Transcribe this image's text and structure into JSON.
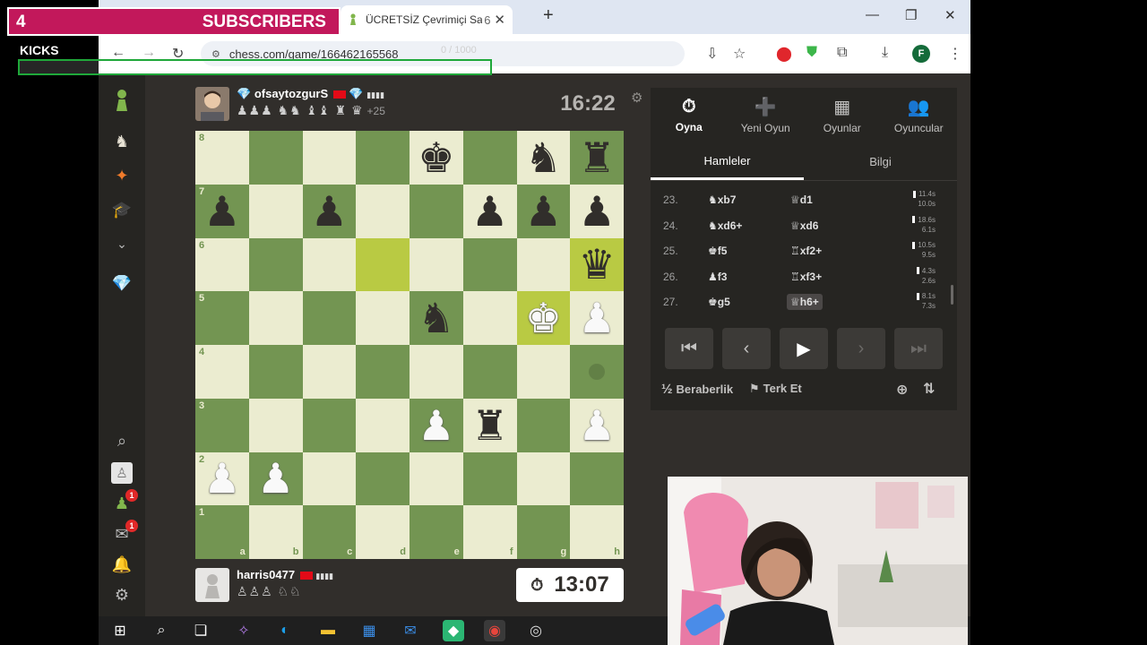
{
  "overlay": {
    "subscriber_count": "4",
    "subscriber_label": "SUBSCRIBERS",
    "kicks_label": "KICKS",
    "progress_text": "0 / 1000",
    "progress_fraction": 0
  },
  "browser": {
    "tab_title": "ÜCRETSİZ Çevrimiçi Satranç Oyunu",
    "tab_badge": "6",
    "url": "chess.com/game/166462165568",
    "profile_letter": "F"
  },
  "game": {
    "top_player": {
      "name": "ofsaytozgurS",
      "rating_dots": "▮▮▮▮",
      "captured": "♟♟♟ ♞♞ ♝♝ ♜ ♛",
      "advantage": "+25",
      "clock": "16:22"
    },
    "bottom_player": {
      "name": "harris0477",
      "rating_dots": "▮▮▮▮",
      "captured": "♙♙♙ ♘♘",
      "clock": "13:07"
    },
    "board": {
      "ranks": [
        "8",
        "7",
        "6",
        "5",
        "4",
        "3",
        "2",
        "1"
      ],
      "files": [
        "a",
        "b",
        "c",
        "d",
        "e",
        "f",
        "g",
        "h"
      ],
      "rows": [
        [
          "",
          "",
          "",
          "",
          "bk",
          "",
          "bn",
          "br"
        ],
        [
          "bp",
          "",
          "bp",
          "",
          "",
          "bp",
          "bp",
          "bp"
        ],
        [
          "",
          "",
          "",
          "",
          "",
          "",
          "",
          "bq"
        ],
        [
          "",
          "",
          "",
          "",
          "bn",
          "",
          "wk",
          "wp"
        ],
        [
          "",
          "",
          "",
          "",
          "",
          "",
          "",
          ""
        ],
        [
          "",
          "",
          "",
          "",
          "wp",
          "br",
          "",
          "wp"
        ],
        [
          "wp",
          "wp",
          "",
          "",
          "",
          "",
          "",
          ""
        ],
        [
          "",
          "",
          "",
          "",
          "",
          "",
          "",
          ""
        ]
      ],
      "highlights": [
        "d6",
        "h6",
        "g5"
      ],
      "move_hint": "h4"
    }
  },
  "panel": {
    "tabs": [
      {
        "label": "Oyna",
        "icon": "stopwatch-icon",
        "glyph": "⏱"
      },
      {
        "label": "Yeni Oyun",
        "icon": "plus-icon",
        "glyph": "➕"
      },
      {
        "label": "Oyunlar",
        "icon": "board-icon",
        "glyph": "▦"
      },
      {
        "label": "Oyuncular",
        "icon": "players-icon",
        "glyph": "👥"
      }
    ],
    "subtabs": [
      {
        "label": "Hamleler"
      },
      {
        "label": "Bilgi"
      }
    ],
    "moves": [
      {
        "num": "23.",
        "white": "♞xb7",
        "black": "♕d1",
        "t1": "11.4s",
        "t2": "10.0s"
      },
      {
        "num": "24.",
        "white": "♞xd6+",
        "black": "♕xd6",
        "t1": "18.6s",
        "t2": "6.1s"
      },
      {
        "num": "25.",
        "white": "♚f5",
        "black": "♖xf2+",
        "t1": "10.5s",
        "t2": "9.5s"
      },
      {
        "num": "26.",
        "white": "♟f3",
        "black": "♖xf3+",
        "t1": "4.3s",
        "t2": "2.6s"
      },
      {
        "num": "27.",
        "white": "♚g5",
        "black": "♕h6+",
        "t1": "8.1s",
        "t2": "7.3s"
      }
    ],
    "draw_label": "Beraberlik",
    "resign_label": "Terk Et",
    "draw_symbol": "½"
  },
  "colors": {
    "board_light": "#ebecd0",
    "board_dark": "#739552",
    "highlight_light": "#f5f682",
    "highlight_dark": "#b9ca43",
    "overlay_pink": "#c2185b",
    "progress_green": "#1fa83a"
  }
}
